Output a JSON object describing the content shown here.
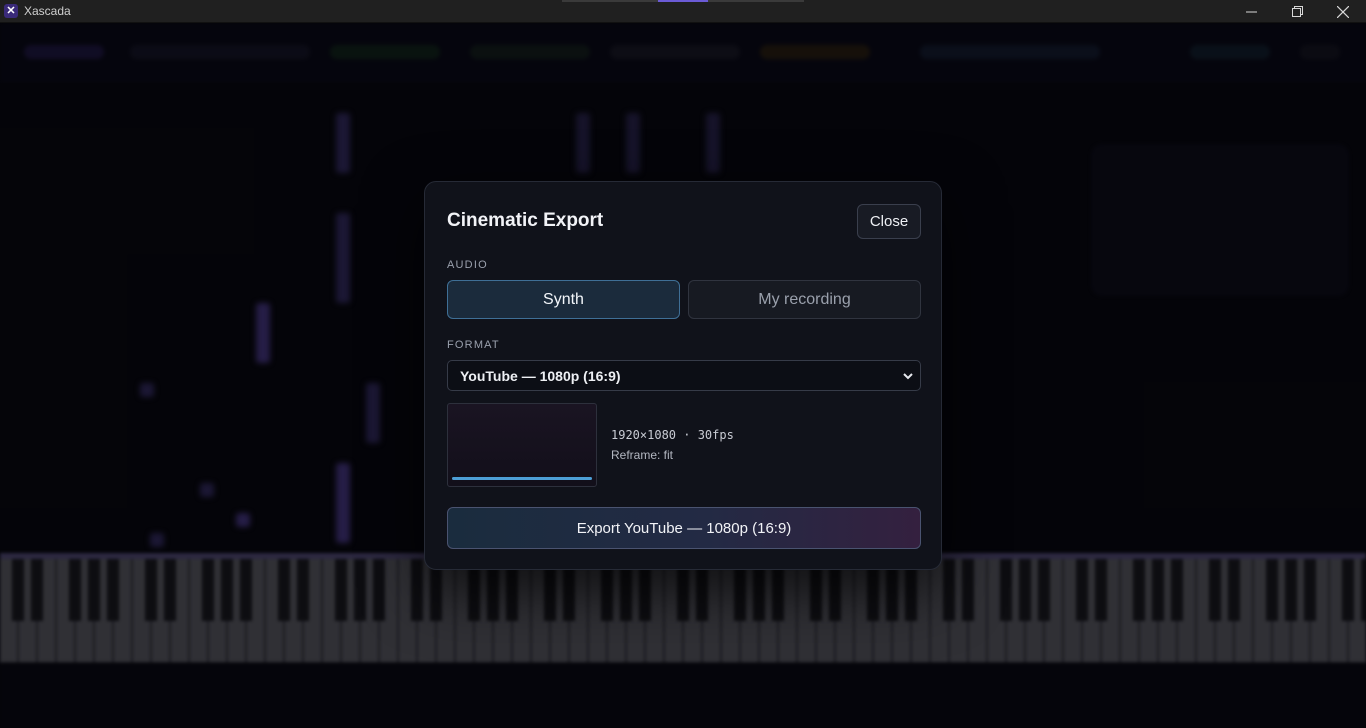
{
  "window": {
    "title": "Xascada",
    "controls": {
      "minimize_icon": "minimize-icon",
      "maximize_icon": "restore-icon",
      "close_icon": "close-icon"
    }
  },
  "modal": {
    "title": "Cinematic Export",
    "close_label": "Close",
    "audio": {
      "label": "AUDIO",
      "options": [
        {
          "label": "Synth",
          "selected": true
        },
        {
          "label": "My recording",
          "selected": false
        }
      ]
    },
    "format": {
      "label": "FORMAT",
      "selected": "YouTube — 1080p (16:9)"
    },
    "preview": {
      "resolution": "1920×1080 · 30fps",
      "reframe": "Reframe: fit",
      "progress": 1.0
    },
    "export_label": "Export YouTube — 1080p (16:9)"
  },
  "colors": {
    "accent_blue": "#4d9fd6",
    "accent_purple": "#34203f",
    "modal_bg": "#10121a",
    "page_bg": "#07070f"
  }
}
